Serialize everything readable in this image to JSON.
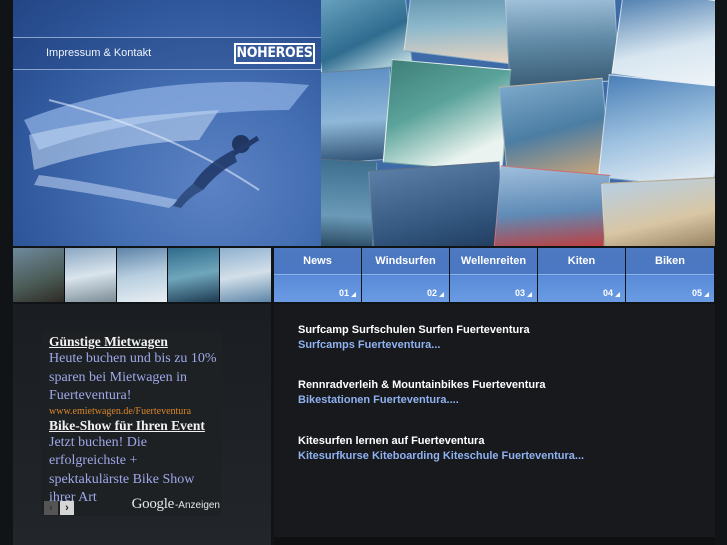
{
  "header": {
    "impressum_link": "Impressum & Kontakt",
    "logo_text": "NOHEROES"
  },
  "nav": {
    "items": [
      {
        "label": "News",
        "number": "01"
      },
      {
        "label": "Windsurfen",
        "number": "02"
      },
      {
        "label": "Wellenreiten",
        "number": "03"
      },
      {
        "label": "Kiten",
        "number": "04"
      },
      {
        "label": "Biken",
        "number": "05"
      }
    ]
  },
  "ads": {
    "ad1_title": "Günstige Mietwagen",
    "ad1_text": "Heute buchen und bis zu 10% sparen bei Mietwagen in Fuerteventura!",
    "ad1_url": "www.emietwagen.de/Fuerteventura",
    "ad2_title": "Bike-Show für Ihren Event",
    "ad2_text": "Jetzt buchen! Die erfolgreichste + spektakulärste Bike Show ihrer Art",
    "google_brand": "Google",
    "google_suffix": "-Anzeigen",
    "prev_icon": "‹",
    "next_icon": "›"
  },
  "content": {
    "links": [
      {
        "title": "Surfcamp Surfschulen Surfen Fuerteventura",
        "sub": "Surfcamps Fuerteventura..."
      },
      {
        "title": "Rennradverleih & Mountainbikes Fuerteventura",
        "sub": "Bikestationen Fuerteventura...."
      },
      {
        "title": "Kitesurfen lernen auf Fuerteventura",
        "sub": "Kitesurfkurse Kiteboarding Kiteschule Fuerteventura..."
      }
    ]
  },
  "colors": {
    "nav_blue": "#4b78c3",
    "link_blue": "#8fb2f0",
    "ad_text": "#9fa8e8",
    "ad_url": "#d9852a",
    "background": "#111417"
  }
}
